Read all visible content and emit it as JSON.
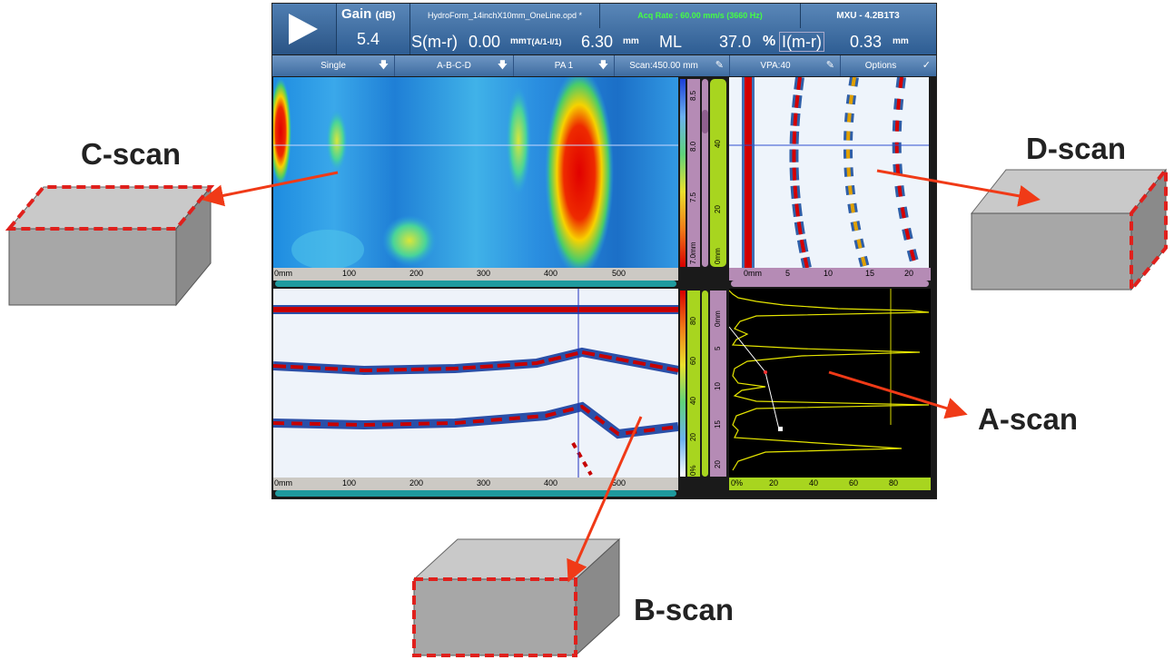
{
  "toolbar_top": {
    "gain_label": "Gain",
    "gain_unit": "(dB)",
    "gain_value": "5.4",
    "filename": "HydroForm_14inchX10mm_OneLine.opd *",
    "acq_rate": "Acq Rate : 60.00 mm/s (3660 Hz)",
    "device": "MXU - 4.2B1T3"
  },
  "readings": {
    "s_label": "S(m-r)",
    "s_value": "0.00",
    "s_unit": "mm",
    "t_label": "T(A/1-I/1)",
    "t_value": "6.30",
    "t_unit": "mm",
    "ml_label": "ML",
    "ml_value": "37.0",
    "ml_unit": "%",
    "i_label": "I(m-r)",
    "i_value": "0.33",
    "i_unit": "mm"
  },
  "toolbar": {
    "single": "Single",
    "layout": "A-B-C-D",
    "pa": "PA 1",
    "scan": "Scan:450.00 mm",
    "vpa": "VPA:40",
    "options": "Options"
  },
  "cscan": {
    "ruler": [
      "0mm",
      "100",
      "200",
      "300",
      "400",
      "500"
    ],
    "scale": [
      "8.5",
      "8.0",
      "7.5",
      "7.0mm"
    ],
    "scale2": [
      "40",
      "20",
      "0mm"
    ]
  },
  "dscan": {
    "ruler": [
      "0mm",
      "5",
      "10",
      "15",
      "20"
    ]
  },
  "bscan": {
    "ruler": [
      "0mm",
      "100",
      "200",
      "300",
      "400",
      "500"
    ],
    "scale": [
      "80",
      "60",
      "40",
      "20",
      "0%"
    ],
    "scale2": [
      "0mm",
      "5",
      "10",
      "15",
      "20"
    ]
  },
  "ascan": {
    "ruler": [
      "0%",
      "20",
      "40",
      "60",
      "80"
    ]
  },
  "labels": {
    "c": "C-scan",
    "d": "D-scan",
    "a": "A-scan",
    "b": "B-scan"
  },
  "colors": {
    "arrow": "#f03a17",
    "dash": "#e0201c",
    "block_front": "#a7a7a7",
    "block_top": "#c9c9c9",
    "block_side": "#8a8a8a",
    "green_ruler": "#a8d51f",
    "purple_ruler": "#b58bb5"
  }
}
